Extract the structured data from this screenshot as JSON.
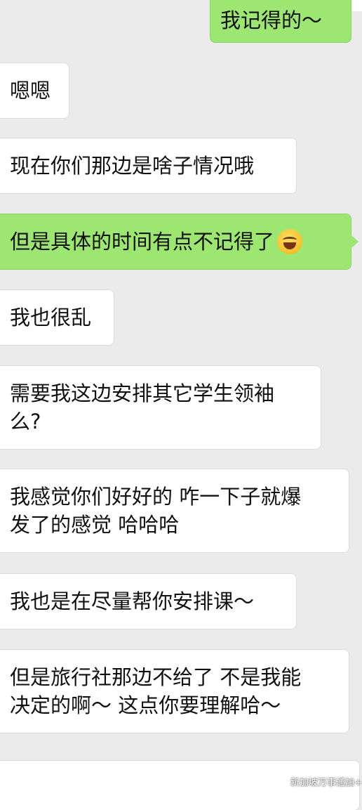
{
  "messages": [
    {
      "side": "out",
      "text": "我记得的～"
    },
    {
      "side": "in",
      "text": "嗯嗯"
    },
    {
      "side": "in",
      "text": "现在你们那边是啥子情况哦"
    },
    {
      "side": "out",
      "text": "但是具体的时间有点不记得了",
      "emoji": "laughing-tears-icon"
    },
    {
      "side": "in",
      "text": "我也很乱"
    },
    {
      "side": "in",
      "line1": "需要我这边安排其它学生领袖",
      "line2": "么?"
    },
    {
      "side": "in",
      "line1": "我感觉你们好好的 咋一下子就爆",
      "line2": "发了的感觉 哈哈哈"
    },
    {
      "side": "in",
      "text": "我也是在尽量帮你安排课～"
    },
    {
      "side": "in",
      "line1": "但是旅行社那边不给了 不是我能",
      "line2": "决定的啊～ 这点你要理解哈～"
    }
  ],
  "watermark": {
    "text": "新加坡万事通加+",
    "icon": "wechat-logo-icon"
  }
}
